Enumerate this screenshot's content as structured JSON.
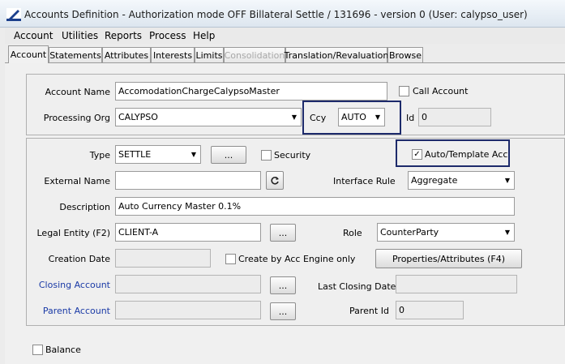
{
  "window": {
    "title": "Accounts Definition - Authorization mode OFF Billateral Settle / 131696 - version 0 (User: calypso_user)"
  },
  "menu": [
    "Account",
    "Utilities",
    "Reports",
    "Process",
    "Help"
  ],
  "tabs": [
    "Account",
    "Statements",
    "Attributes",
    "Interests",
    "Limits",
    "Consolidation",
    "Translation/Revaluation",
    "Browse"
  ],
  "top_group": {
    "account_name_label": "Account Name",
    "account_name_value": "AccomodationChargeCalypsoMaster",
    "call_account_label": "Call Account",
    "processing_org_label": "Processing Org",
    "processing_org_value": "CALYPSO",
    "ccy_label": "Ccy",
    "ccy_value": "AUTO",
    "id_label": "Id",
    "id_value": "0"
  },
  "main_group": {
    "type_label": "Type",
    "type_value": "SETTLE",
    "type_button": "...",
    "security_label": "Security",
    "auto_template_label": "Auto/Template Acc",
    "auto_template_checked": true,
    "external_name_label": "External Name",
    "external_name_value": "",
    "interface_rule_label": "Interface Rule",
    "interface_rule_value": "Aggregate",
    "description_label": "Description",
    "description_value": "Auto Currency Master 0.1%",
    "legal_entity_label": "Legal Entity (F2)",
    "legal_entity_value": "CLIENT-A",
    "legal_entity_button": "...",
    "role_label": "Role",
    "role_value": "CounterParty",
    "creation_date_label": "Creation Date",
    "creation_date_value": "",
    "create_by_engine_label": "Create by Acc Engine only",
    "properties_button": "Properties/Attributes (F4)",
    "closing_account_label": "Closing Account",
    "closing_account_value": "",
    "closing_account_button": "...",
    "last_closing_date_label": "Last Closing Date",
    "last_closing_date_value": "",
    "parent_account_label": "Parent Account",
    "parent_account_value": "",
    "parent_account_button": "...",
    "parent_id_label": "Parent Id",
    "parent_id_value": "0"
  },
  "bottom": {
    "balance_label": "Balance"
  },
  "colors": {
    "highlight_box": "#1d2a6b",
    "link_label": "#1a3aa6"
  }
}
